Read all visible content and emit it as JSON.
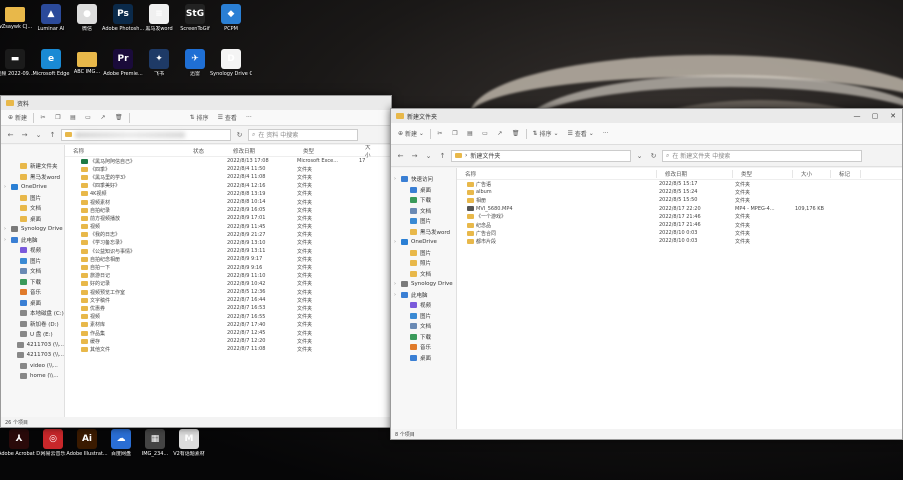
{
  "desktop": {
    "icons_top": [
      {
        "label": "wZsaywk CJ...",
        "icon": "folder-icon",
        "color": "#e8b84a",
        "glyph": ""
      },
      {
        "label": "Luminar AI",
        "icon": "luminar-icon",
        "color": "#2b4a9a",
        "glyph": "▲"
      },
      {
        "label": "微信",
        "icon": "wechat-icon",
        "color": "#dddddd",
        "glyph": "●"
      },
      {
        "label": "Adobe Photosh...",
        "icon": "photoshop-icon",
        "color": "#0b2a4a",
        "glyph": "Ps"
      },
      {
        "label": "黑马发word",
        "icon": "document-icon",
        "color": "#f0f0f0",
        "glyph": "≡"
      },
      {
        "label": "ScreenToGif",
        "icon": "screentogif-icon",
        "color": "#222222",
        "glyph": "StG"
      },
      {
        "label": "PCPM",
        "icon": "pcpm-icon",
        "color": "#2a7fd4",
        "glyph": "◆"
      }
    ],
    "icons_second": [
      {
        "label": "视频 2022-09...",
        "icon": "video-file-icon",
        "color": "#1b1b1b",
        "glyph": "▬"
      },
      {
        "label": "Microsoft Edge",
        "icon": "edge-icon",
        "color": "#1a8ad4",
        "glyph": "e"
      },
      {
        "label": "ABC IMG...",
        "icon": "folder-icon",
        "color": "#e8b84a",
        "glyph": ""
      },
      {
        "label": "Adobe Premie...",
        "icon": "premiere-icon",
        "color": "#1a0b3a",
        "glyph": "Pr"
      },
      {
        "label": "飞书",
        "icon": "feishu-icon",
        "color": "#1e3a66",
        "glyph": "✦"
      },
      {
        "label": "迅雷",
        "icon": "xunlei-icon",
        "color": "#1f6fd4",
        "glyph": "✈"
      },
      {
        "label": "Synology Drive Cli...",
        "icon": "synology-drive-icon",
        "color": "#f4f4f4",
        "glyph": "D"
      }
    ],
    "icons_bottom": [
      {
        "label": "Adobe Acrobat DC",
        "icon": "acrobat-icon",
        "color": "#2a0a0a",
        "glyph": "⅄"
      },
      {
        "label": "网易云音乐",
        "icon": "netease-music-icon",
        "color": "#c8272a",
        "glyph": "◎"
      },
      {
        "label": "Adobe Illustrat...",
        "icon": "illustrator-icon",
        "color": "#3a1a00",
        "glyph": "Ai"
      },
      {
        "label": "百度网盘",
        "icon": "baidu-netdisk-icon",
        "color": "#2a6ed4",
        "glyph": "☁"
      },
      {
        "label": "IMG_234...",
        "icon": "image-file-icon",
        "color": "#444444",
        "glyph": "▦"
      },
      {
        "label": "V2有话题素材",
        "icon": "media-icon",
        "color": "#dcdcdc",
        "glyph": "M"
      }
    ]
  },
  "left_window": {
    "title": "资料",
    "toolbar": {
      "new": "新建",
      "sort": "排序",
      "view": "查看",
      "more": "···"
    },
    "search_placeholder": "在 资料 中搜索",
    "sidebar": [
      {
        "label": "新建文件夹",
        "icon": "folder-icon",
        "color": "#e8b84a",
        "indent": 1
      },
      {
        "label": "黑马发word",
        "icon": "folder-icon",
        "color": "#e8b84a",
        "indent": 1
      },
      {
        "label": "OneDrive",
        "icon": "onedrive-icon",
        "color": "#2a7fd4",
        "indent": 0
      },
      {
        "label": "图片",
        "icon": "folder-icon",
        "color": "#e8b84a",
        "indent": 1
      },
      {
        "label": "文档",
        "icon": "folder-icon",
        "color": "#e8b84a",
        "indent": 1
      },
      {
        "label": "桌面",
        "icon": "folder-icon",
        "color": "#e8b84a",
        "indent": 1
      },
      {
        "label": "Synology Drive",
        "icon": "synology-drive-icon",
        "color": "#7a7a7a",
        "indent": 0
      },
      {
        "label": "此电脑",
        "icon": "pc-icon",
        "color": "#3a7fd4",
        "indent": 0
      },
      {
        "label": "视频",
        "icon": "video-icon",
        "color": "#7a5adb",
        "indent": 1
      },
      {
        "label": "图片",
        "icon": "picture-icon",
        "color": "#3a8ad4",
        "indent": 1
      },
      {
        "label": "文档",
        "icon": "document-icon",
        "color": "#6a8ab4",
        "indent": 1
      },
      {
        "label": "下载",
        "icon": "download-icon",
        "color": "#3a9a5a",
        "indent": 1
      },
      {
        "label": "音乐",
        "icon": "music-icon",
        "color": "#e07a2a",
        "indent": 1
      },
      {
        "label": "桌面",
        "icon": "desktop-icon",
        "color": "#3a7fd4",
        "indent": 1
      },
      {
        "label": "本地磁盘 (C:)",
        "icon": "drive-icon",
        "color": "#888888",
        "indent": 1
      },
      {
        "label": "新加卷 (D:)",
        "icon": "drive-icon",
        "color": "#888888",
        "indent": 1
      },
      {
        "label": "U 盘 (E:)",
        "icon": "drive-icon",
        "color": "#888888",
        "indent": 1
      },
      {
        "label": "4211703 (\\\\...",
        "icon": "network-drive-icon",
        "color": "#888888",
        "indent": 1
      },
      {
        "label": "4211703 (\\\\...",
        "icon": "network-drive-icon",
        "color": "#888888",
        "indent": 1
      },
      {
        "label": "video (\\\\...",
        "icon": "network-drive-icon",
        "color": "#888888",
        "indent": 1
      },
      {
        "label": "home (\\\\...",
        "icon": "network-drive-icon",
        "color": "#888888",
        "indent": 1
      }
    ],
    "columns": [
      "名称",
      "状态",
      "修改日期",
      "类型",
      "大小"
    ],
    "rows": [
      {
        "name": "《黑马阿阿信自己》",
        "date": "2022/8/13 17:08",
        "type": "Microsoft Exce...",
        "size": "17"
      },
      {
        "name": "《四季》",
        "date": "2022/8/4 11:50",
        "type": "文件夹",
        "size": ""
      },
      {
        "name": "《黑马里的学3》",
        "date": "2022/8/4 11:08",
        "type": "文件夹",
        "size": ""
      },
      {
        "name": "《四季美好》",
        "date": "2022/8/4 12:16",
        "type": "文件夹",
        "size": ""
      },
      {
        "name": "4K视频",
        "date": "2022/8/8 13:19",
        "type": "文件夹",
        "size": ""
      },
      {
        "name": "视频素材",
        "date": "2022/8/8 10:14",
        "type": "文件夹",
        "size": ""
      },
      {
        "name": "自拍纪录",
        "date": "2022/8/9 16:05",
        "type": "文件夹",
        "size": ""
      },
      {
        "name": "前方视频播放",
        "date": "2022/8/9 17:01",
        "type": "文件夹",
        "size": ""
      },
      {
        "name": "视频",
        "date": "2022/8/9 11:45",
        "type": "文件夹",
        "size": ""
      },
      {
        "name": "《我的日志》",
        "date": "2022/8/9 21:27",
        "type": "文件夹",
        "size": ""
      },
      {
        "name": "《学习备忘录》",
        "date": "2022/8/9 13:10",
        "type": "文件夹",
        "size": ""
      },
      {
        "name": "《公益知识与事情》",
        "date": "2022/8/9 13:11",
        "type": "文件夹",
        "size": ""
      },
      {
        "name": "自拍纪念相册",
        "date": "2022/8/9 9:17",
        "type": "文件夹",
        "size": ""
      },
      {
        "name": "自拍一下",
        "date": "2022/8/9 9:16",
        "type": "文件夹",
        "size": ""
      },
      {
        "name": "旅游日记",
        "date": "2022/8/9 11:10",
        "type": "文件夹",
        "size": ""
      },
      {
        "name": "好的记录",
        "date": "2022/8/9 10:42",
        "type": "文件夹",
        "size": ""
      },
      {
        "name": "视频预览工作室",
        "date": "2022/8/5 12:36",
        "type": "文件夹",
        "size": ""
      },
      {
        "name": "文字稿件",
        "date": "2022/8/7 16:44",
        "type": "文件夹",
        "size": ""
      },
      {
        "name": "优惠券",
        "date": "2022/8/7 16:53",
        "type": "文件夹",
        "size": ""
      },
      {
        "name": "视频",
        "date": "2022/8/7 16:55",
        "type": "文件夹",
        "size": ""
      },
      {
        "name": "素材库",
        "date": "2022/8/7 17:40",
        "type": "文件夹",
        "size": ""
      },
      {
        "name": "作品集",
        "date": "2022/8/7 12:45",
        "type": "文件夹",
        "size": ""
      },
      {
        "name": "缓存",
        "date": "2022/8/7 12:20",
        "type": "文件夹",
        "size": ""
      },
      {
        "name": "其他文件",
        "date": "2022/8/7 11:08",
        "type": "文件夹",
        "size": ""
      }
    ],
    "status": "26 个项目"
  },
  "right_window": {
    "title": "新建文件夹",
    "toolbar": {
      "new": "新建",
      "sort": "排序",
      "view": "查看",
      "more": "···"
    },
    "address": "新建文件夹",
    "search_placeholder": "在 新建文件夹 中搜索",
    "sidebar": [
      {
        "label": "快速访问",
        "icon": "star-icon",
        "color": "#3a7fd4",
        "indent": 0
      },
      {
        "label": "桌面",
        "icon": "desktop-icon",
        "color": "#3a7fd4",
        "indent": 1
      },
      {
        "label": "下载",
        "icon": "download-icon",
        "color": "#3a9a5a",
        "indent": 1
      },
      {
        "label": "文档",
        "icon": "document-icon",
        "color": "#6a8ab4",
        "indent": 1
      },
      {
        "label": "图片",
        "icon": "picture-icon",
        "color": "#3a8ad4",
        "indent": 1
      },
      {
        "label": "黑马发word",
        "icon": "folder-icon",
        "color": "#e8b84a",
        "indent": 1
      },
      {
        "label": "OneDrive",
        "icon": "onedrive-icon",
        "color": "#2a7fd4",
        "indent": 0
      },
      {
        "label": "图片",
        "icon": "folder-icon",
        "color": "#e8b84a",
        "indent": 1
      },
      {
        "label": "照片",
        "icon": "folder-icon",
        "color": "#e8b84a",
        "indent": 1
      },
      {
        "label": "文档",
        "icon": "folder-icon",
        "color": "#e8b84a",
        "indent": 1
      },
      {
        "label": "Synology Drive",
        "icon": "synology-drive-icon",
        "color": "#7a7a7a",
        "indent": 0
      },
      {
        "label": "此电脑",
        "icon": "pc-icon",
        "color": "#3a7fd4",
        "indent": 0
      },
      {
        "label": "视频",
        "icon": "video-icon",
        "color": "#7a5adb",
        "indent": 1
      },
      {
        "label": "图片",
        "icon": "picture-icon",
        "color": "#3a8ad4",
        "indent": 1
      },
      {
        "label": "文档",
        "icon": "document-icon",
        "color": "#6a8ab4",
        "indent": 1
      },
      {
        "label": "下载",
        "icon": "download-icon",
        "color": "#3a9a5a",
        "indent": 1
      },
      {
        "label": "音乐",
        "icon": "music-icon",
        "color": "#e07a2a",
        "indent": 1
      },
      {
        "label": "桌面",
        "icon": "desktop-icon",
        "color": "#3a7fd4",
        "indent": 1
      }
    ],
    "columns": [
      "名称",
      "修改日期",
      "类型",
      "大小",
      "标记"
    ],
    "rows": [
      {
        "name": "广告语",
        "date": "2022/8/5 15:17",
        "type": "文件夹",
        "size": "",
        "kind": "folder"
      },
      {
        "name": "album",
        "date": "2022/8/5 15:24",
        "type": "文件夹",
        "size": "",
        "kind": "folder"
      },
      {
        "name": "相册",
        "date": "2022/8/5 15:50",
        "type": "文件夹",
        "size": "",
        "kind": "folder"
      },
      {
        "name": "MVI_5680.MP4",
        "date": "2022/8/17 22:20",
        "type": "MP4 - MPEG-4...",
        "size": "109,176 KB",
        "kind": "video"
      },
      {
        "name": "《一个游戏》",
        "date": "2022/8/17 21:46",
        "type": "文件夹",
        "size": "",
        "kind": "folder"
      },
      {
        "name": "纪念品",
        "date": "2022/8/17 21:46",
        "type": "文件夹",
        "size": "",
        "kind": "folder"
      },
      {
        "name": "广告合同",
        "date": "2022/8/10 0:03",
        "type": "文件夹",
        "size": "",
        "kind": "folder"
      },
      {
        "name": "都市片段",
        "date": "2022/8/10 0:03",
        "type": "文件夹",
        "size": "",
        "kind": "folder"
      }
    ],
    "status": "8 个项目"
  }
}
